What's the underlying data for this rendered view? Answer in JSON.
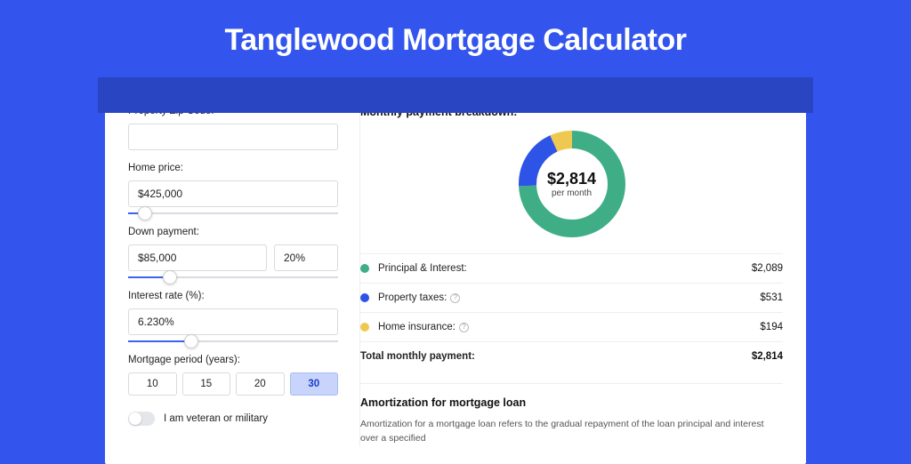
{
  "page_title": "Tanglewood Mortgage Calculator",
  "form": {
    "zip_label": "Property Zip Code:",
    "zip_value": "",
    "home_price_label": "Home price:",
    "home_price_value": "$425,000",
    "down_payment_label": "Down payment:",
    "down_payment_value": "$85,000",
    "down_payment_pct": "20%",
    "interest_label": "Interest rate (%):",
    "interest_value": "6.230%",
    "period_label": "Mortgage period (years):",
    "periods": [
      "10",
      "15",
      "20",
      "30"
    ],
    "period_selected": "30",
    "veteran_label": "I am veteran or military"
  },
  "breakdown": {
    "title": "Monthly payment breakdown:",
    "center_amount": "$2,814",
    "center_sub": "per month",
    "rows": [
      {
        "label": "Principal & Interest:",
        "value": "$2,089",
        "color": "#3fae87",
        "info": false
      },
      {
        "label": "Property taxes:",
        "value": "$531",
        "color": "#2d54e6",
        "info": true
      },
      {
        "label": "Home insurance:",
        "value": "$194",
        "color": "#efc851",
        "info": true
      }
    ],
    "total_label": "Total monthly payment:",
    "total_value": "$2,814"
  },
  "amort": {
    "title": "Amortization for mortgage loan",
    "text": "Amortization for a mortgage loan refers to the gradual repayment of the loan principal and interest over a specified"
  },
  "chart_data": {
    "type": "pie",
    "title": "Monthly payment breakdown",
    "series": [
      {
        "name": "Principal & Interest",
        "value": 2089,
        "color": "#3fae87"
      },
      {
        "name": "Property taxes",
        "value": 531,
        "color": "#2d54e6"
      },
      {
        "name": "Home insurance",
        "value": 194,
        "color": "#efc851"
      }
    ],
    "total": 2814,
    "unit": "USD/month"
  }
}
